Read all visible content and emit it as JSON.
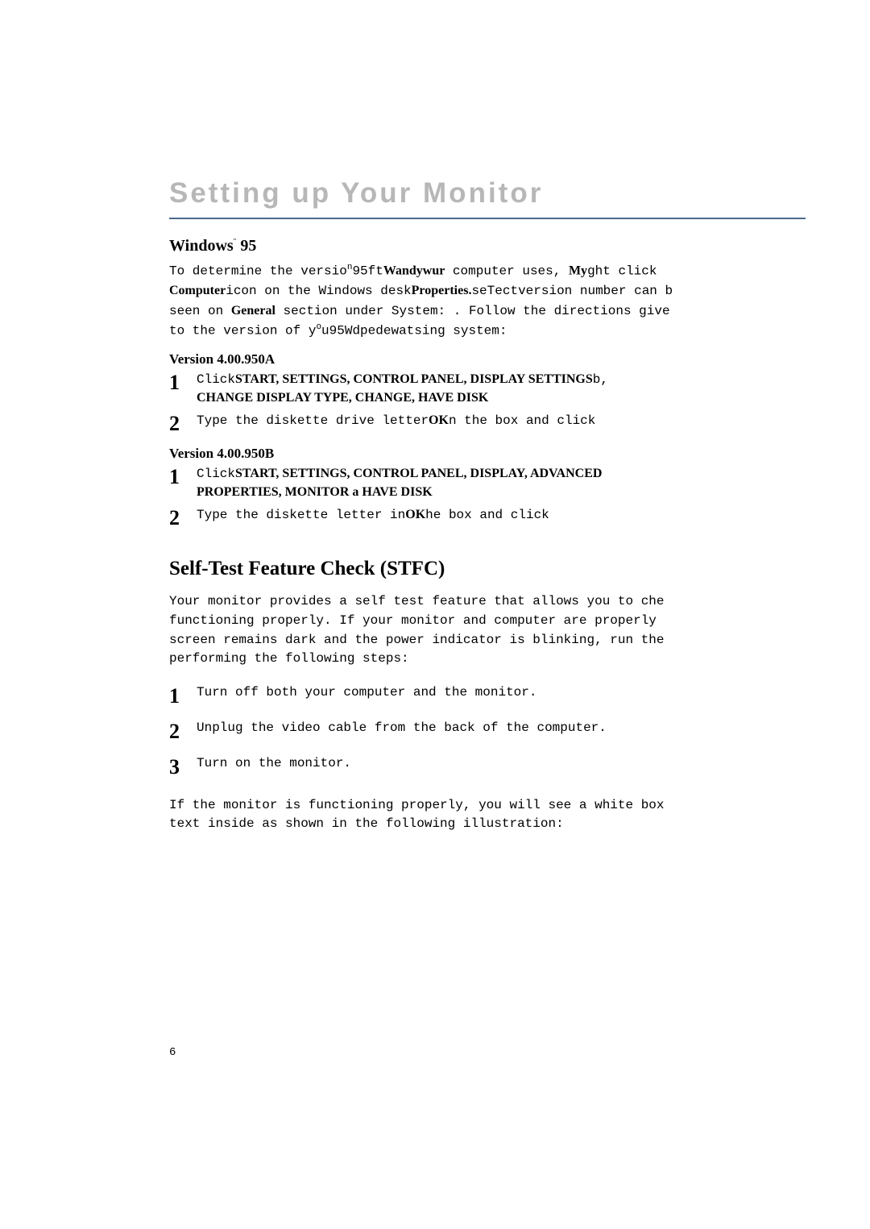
{
  "title": "Setting up Your Monitor",
  "win95": {
    "heading_a": "Windows",
    "heading_b": " 95",
    "sup": "¨",
    "intro_l1a": "To determine the versio",
    "intro_l1b": "n",
    "intro_l1c": "95ft",
    "intro_l1d": "Wandywur",
    "intro_l1e": " computer uses, ",
    "intro_l1f": "My",
    "intro_l1g": "ght click ",
    "intro_l2a": "Computer",
    "intro_l2b": "icon on the Windows desk",
    "intro_l2c": "Properties.",
    "intro_l2d": "seTect",
    "intro_l2e": "version number can b",
    "intro_l3a": "seen on ",
    "intro_l3b": "General",
    "intro_l3c": " section under  System: . Follow the directions give",
    "intro_l4a": "to the version of y",
    "intro_l4b": "o",
    "intro_l4c": "u95Wdpedewatsing system:",
    "verA": "Version 4.00.950A",
    "a1_l1a": "Click",
    "a1_l1b": "START, SETTINGS, CONTROL PANEL, DISPLAY SETTINGS",
    "a1_l1c": "b,",
    "a1_l2": "CHANGE DISPLAY TYPE, CHANGE, HAVE DISK",
    "a2_a": "Type the diskette drive letter",
    "a2_b": "OK",
    "a2_c": "n the box and click",
    "verB": "Version 4.00.950B",
    "b1_l1a": "Click",
    "b1_l1b": "START, SETTINGS, CONTROL PANEL, DISPLAY, ADVANCED",
    "b1_l2": "PROPERTIES, MONITOR a HAVE DISK",
    "b2_a": "Type the diskette letter in",
    "b2_b": "OK",
    "b2_c": "he box and click"
  },
  "stfc": {
    "heading": "Self-Test Feature Check (STFC)",
    "p1_l1": "Your monitor provides a self test feature that allows you to che",
    "p1_l2": "functioning properly. If your monitor and computer are properly ",
    "p1_l3": "screen remains dark and the power indicator is blinking, run the",
    "p1_l4": "performing the following steps:",
    "s1": "Turn off both your computer and the monitor.",
    "s2": "Unplug the video cable from the back of the computer.",
    "s3": "Turn on the monitor.",
    "p2_l1": "If the monitor is functioning properly, you will see a white box",
    "p2_l2": "text inside as shown in the following illustration:"
  },
  "nums": {
    "n1": "1",
    "n2": "2",
    "n3": "3"
  },
  "page_number": "6"
}
